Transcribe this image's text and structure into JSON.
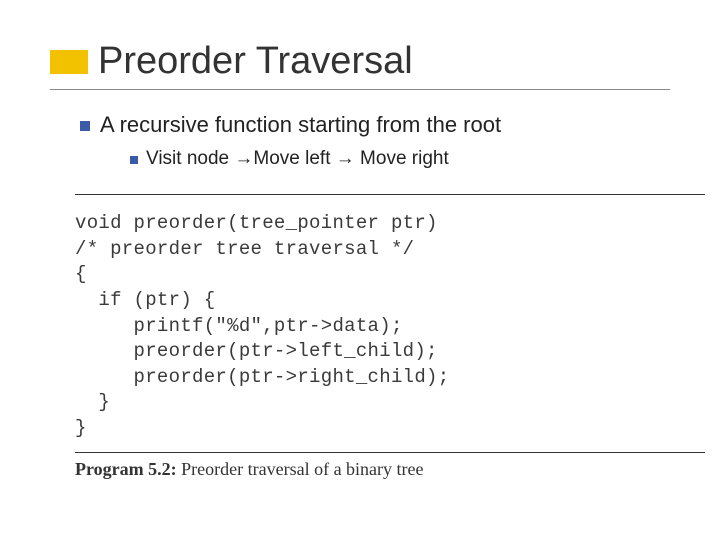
{
  "title": "Preorder Traversal",
  "bullet1": "A recursive function starting from the root",
  "bullet2_parts": {
    "p1": "Visit node ",
    "a1": "→",
    "p2": "Move left ",
    "a2": "→",
    "p3": " Move right"
  },
  "code": "void preorder(tree_pointer ptr)\n/* preorder tree traversal */\n{\n  if (ptr) {\n     printf(\"%d\",ptr->data);\n     preorder(ptr->left_child);\n     preorder(ptr->right_child);\n  }\n}",
  "caption_label": "Program 5.2:",
  "caption_text": " Preorder traversal of a binary tree"
}
